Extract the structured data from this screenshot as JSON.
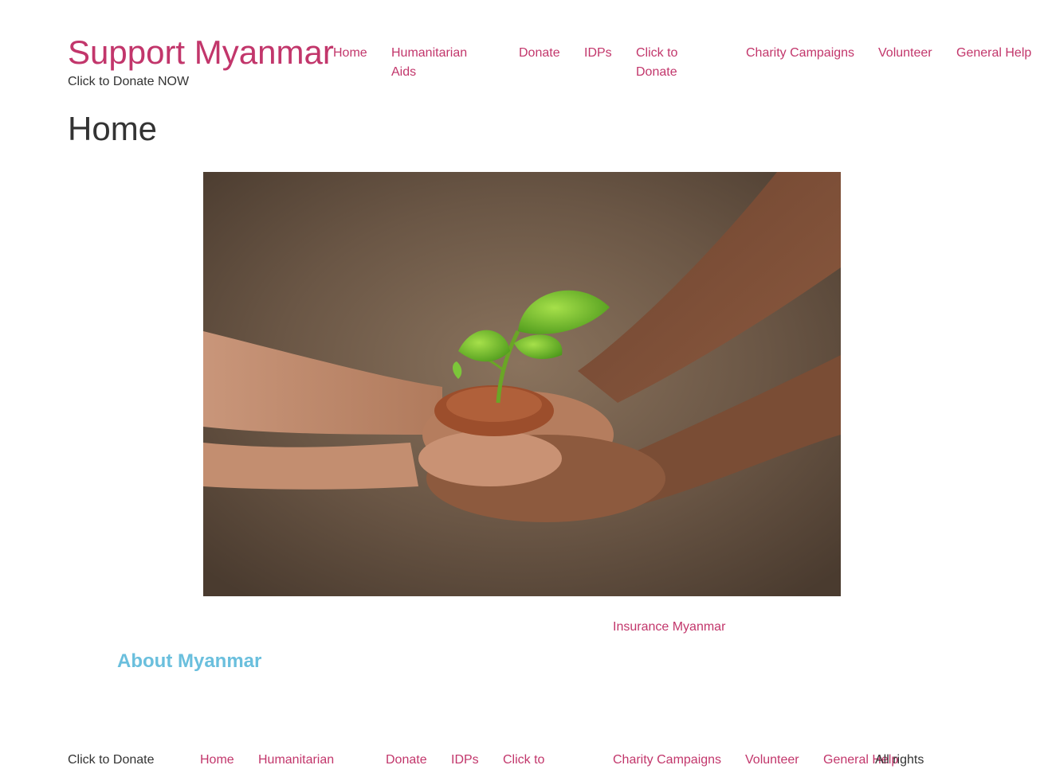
{
  "site": {
    "title": "Support Myanmar",
    "tagline": "Click to Donate NOW"
  },
  "nav": {
    "home": "Home",
    "humanitarian_line1": "Humanitarian",
    "humanitarian_line2": "Aids",
    "donate": "Donate",
    "idps": "IDPs",
    "click_line1": "Click to",
    "click_line2": "Donate",
    "charity": "Charity Campaigns",
    "volunteer": "Volunteer",
    "general_help": "General Help"
  },
  "page": {
    "title": "Home"
  },
  "hero": {
    "description": "hands-holding-seedling-image"
  },
  "content": {
    "insurance_link": "Insurance Myanmar",
    "about_heading": "About Myanmar"
  },
  "footer": {
    "donate_text": "Click to Donate",
    "home": "Home",
    "humanitarian": "Humanitarian",
    "donate": "Donate",
    "idps": "IDPs",
    "click": "Click to",
    "charity": "Charity Campaigns",
    "volunteer": "Volunteer",
    "general_help": "General Help",
    "rights": "All rights"
  },
  "colors": {
    "accent": "#c2366b",
    "heading_blue": "#6abfdd",
    "text": "#333333"
  }
}
